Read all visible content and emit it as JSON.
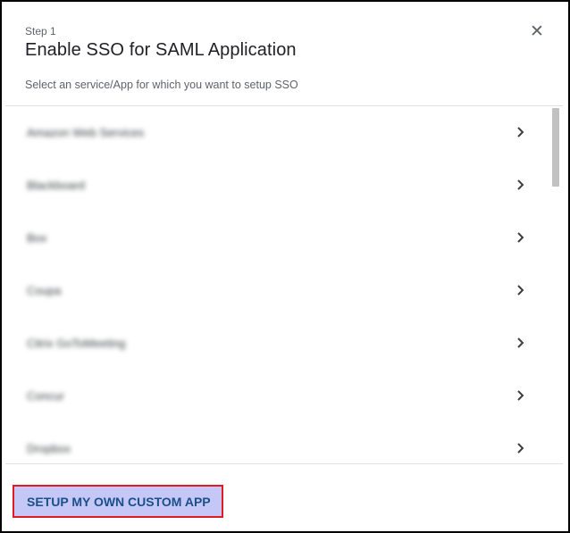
{
  "dialog": {
    "step_label": "Step 1",
    "title": "Enable SSO for SAML Application",
    "subtitle": "Select an service/App for which you want to setup SSO",
    "close_icon": "close-icon"
  },
  "apps": [
    {
      "label": "Amazon Web Services"
    },
    {
      "label": "Blackboard"
    },
    {
      "label": "Box"
    },
    {
      "label": "Coupa"
    },
    {
      "label": "Citrix GoToMeeting"
    },
    {
      "label": "Concur"
    },
    {
      "label": "Dropbox"
    }
  ],
  "footer": {
    "custom_app_label": "SETUP MY OWN CUSTOM APP"
  },
  "colors": {
    "accent_text": "#1a4f8a",
    "highlight_border": "#e01b24",
    "highlight_fill": "#c5c8f7"
  }
}
